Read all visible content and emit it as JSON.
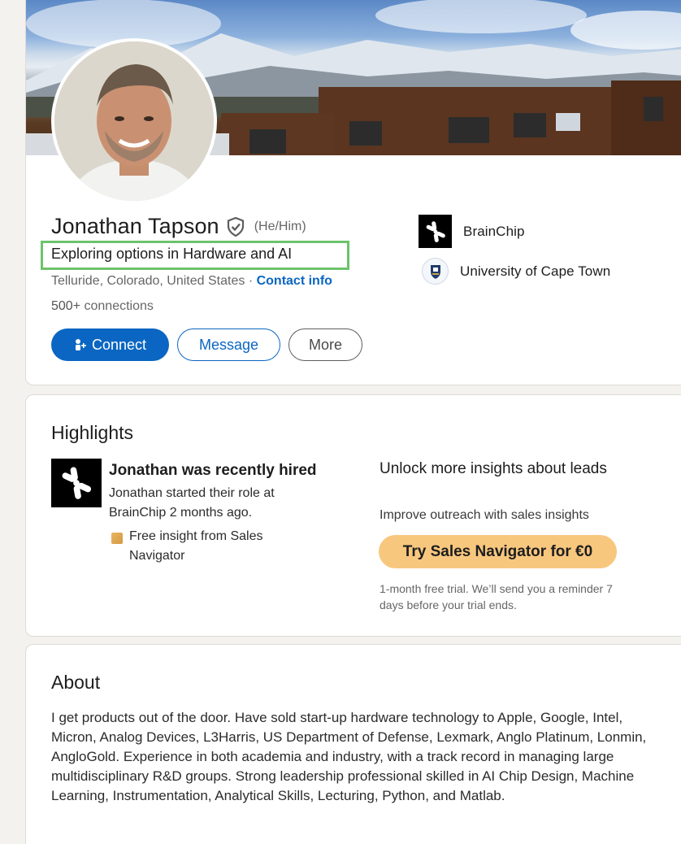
{
  "profile": {
    "name": "Jonathan Tapson",
    "pronouns": "(He/Him)",
    "headline": "Exploring options in Hardware and AI",
    "location": "Telluride, Colorado, United States",
    "location_separator": "·",
    "contact_info": "Contact info",
    "connections_count": "500+",
    "connections_label": "connections",
    "buttons": {
      "connect": "Connect",
      "message": "Message",
      "more": "More"
    },
    "companies": [
      {
        "name": "BrainChip",
        "icon": "brainchip-logo"
      },
      {
        "name": "University of Cape Town",
        "icon": "uct-crest-logo"
      }
    ],
    "colors": {
      "accent": "#0a66c2",
      "highlight_box": "#6cc46b"
    }
  },
  "highlights": {
    "title": "Highlights",
    "hire_title": "Jonathan was recently hired",
    "hire_body": "Jonathan started their role at BrainChip 2 months ago.",
    "insight_text": "Free insight from Sales Navigator",
    "unlock_title": "Unlock more insights about leads",
    "unlock_sub": "Improve outreach with sales insights",
    "sales_nav_button": "Try Sales Navigator for €0",
    "trial_note": "1-month free trial. We’ll send you a reminder 7 days before your trial ends.",
    "colors": {
      "sales_nav_button": "#f8c77e"
    }
  },
  "about": {
    "title": "About",
    "text": "I get products out of the door. Have sold start-up hardware technology to Apple, Google, Intel, Micron, Analog Devices, L3Harris, US Department of Defense, Lexmark, Anglo Platinum, Lonmin, AngloGold. Experience in both academia and industry, with a track record in managing large multidisciplinary R&D groups. Strong leadership professional skilled in AI Chip Design, Machine Learning, Instrumentation, Analytical Skills, Lecturing, Python, and Matlab."
  }
}
